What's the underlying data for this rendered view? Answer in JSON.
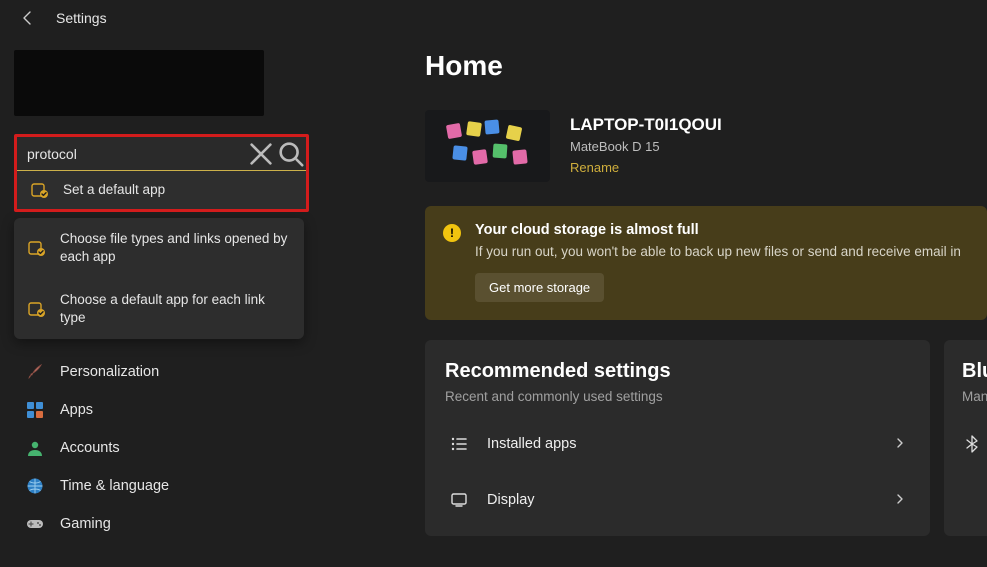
{
  "topbar": {
    "title": "Settings"
  },
  "search": {
    "value": "protocol",
    "clear_aria": "Clear",
    "submit_aria": "Search",
    "results": [
      {
        "label": "Set a default app"
      },
      {
        "label": "Choose file types and links opened by each app"
      },
      {
        "label": "Choose a default app for each link type"
      }
    ]
  },
  "sidebar": {
    "items": [
      {
        "label": "Personalization",
        "icon": "brush"
      },
      {
        "label": "Apps",
        "icon": "apps"
      },
      {
        "label": "Accounts",
        "icon": "person"
      },
      {
        "label": "Time & language",
        "icon": "globe"
      },
      {
        "label": "Gaming",
        "icon": "gamepad"
      }
    ]
  },
  "main": {
    "title": "Home",
    "device": {
      "name": "LAPTOP-T0I1QOUI",
      "model": "MateBook D 15",
      "rename": "Rename"
    },
    "alert": {
      "title": "Your cloud storage is almost full",
      "text": "If you run out, you won't be able to back up new files or send and receive email in",
      "button": "Get more storage"
    },
    "rec": {
      "title": "Recommended settings",
      "subtitle": "Recent and commonly used settings",
      "items": [
        {
          "label": "Installed apps"
        },
        {
          "label": "Display"
        }
      ]
    },
    "side": {
      "title": "Blu",
      "sub": "Man"
    }
  }
}
